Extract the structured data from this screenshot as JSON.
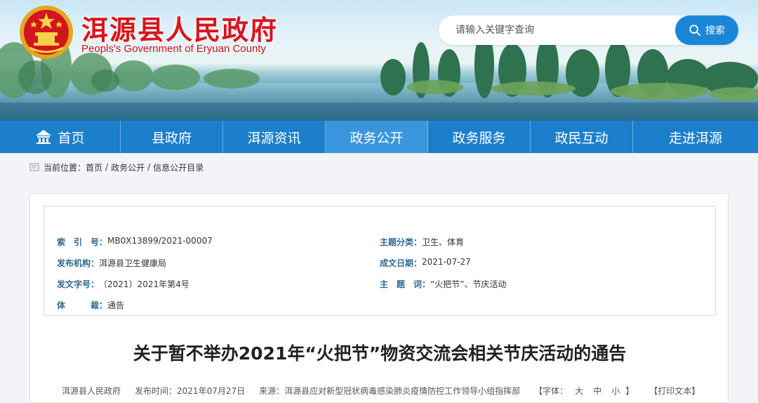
{
  "header": {
    "title": "洱源县人民政府",
    "subtitle": "Peopls's Government of Eryuan County",
    "search_placeholder": "请输入关键字查询",
    "search_button": "搜索"
  },
  "nav": {
    "items": [
      {
        "label": "首页",
        "active": false
      },
      {
        "label": "县政府",
        "active": false
      },
      {
        "label": "洱源资讯",
        "active": false
      },
      {
        "label": "政务公开",
        "active": true
      },
      {
        "label": "政务服务",
        "active": false
      },
      {
        "label": "政民互动",
        "active": false
      },
      {
        "label": "走进洱源",
        "active": false
      }
    ]
  },
  "breadcrumb": {
    "prefix": "当前位置：",
    "items": [
      "首页",
      "政务公开",
      "信息公开目录"
    ],
    "separator": "/"
  },
  "meta": {
    "index_label": "索　引　号：",
    "index_value": "MB0X13899/2021-00007",
    "org_label": "发布机构：",
    "org_value": "洱源县卫生健康局",
    "docno_label": "发文字号：",
    "docno_value": "〔2021〕2021年第4号",
    "genre_label": "体　　　裁：",
    "genre_value": "通告",
    "category_label": "主题分类：",
    "category_value": "卫生、体育",
    "date_label": "成文日期：",
    "date_value": "2021-07-27",
    "keywords_label": "主　题　词：",
    "keywords_value": "“火把节”、节庆活动"
  },
  "article": {
    "title": "关于暂不举办2021年“火把节”物资交流会相关节庆活动的通告",
    "publisher": "洱源县人民政府",
    "time_label": "发布时间：",
    "time_value": "2021年07月27日",
    "source_label": "来源：",
    "source_value": "洱源县应对新型冠状病毒感染肺炎疫情防控工作领导小组指挥部",
    "font_label": "【字体：",
    "font_large": "大",
    "font_medium": "中",
    "font_small": "小",
    "font_close": "】",
    "print_label": "【打印文本】"
  },
  "colors": {
    "nav_bg": "#1c7fcc",
    "nav_active": "#3a96dc",
    "title_red": "#d9151b",
    "search_btn": "#1a86d8"
  },
  "icons": [
    "national-emblem-icon",
    "search-icon",
    "home-icon",
    "location-icon"
  ]
}
